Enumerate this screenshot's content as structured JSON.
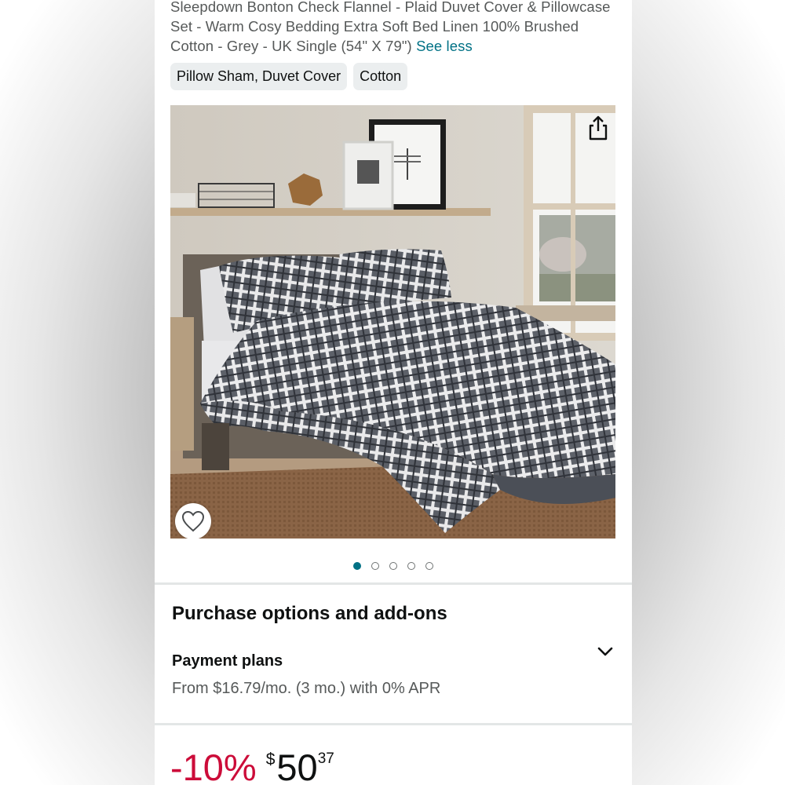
{
  "product": {
    "title": "Sleepdown Bonton Check Flannel - Plaid Duvet Cover & Pillowcase Set - Warm Cosy Bedding Extra Soft Bed Linen 100% Brushed Cotton - Grey - UK Single (54\" X 79\")",
    "see_less": "See less",
    "tags": [
      "Pillow Sham, Duvet Cover",
      "Cotton"
    ],
    "image_alt": "Grey plaid duvet cover and pillowcases on a bed",
    "image_count": 5,
    "active_image_index": 0
  },
  "purchase": {
    "heading": "Purchase options and add-ons",
    "payment_plans_label": "Payment plans",
    "payment_plans_detail": "From $16.79/mo. (3 mo.) with 0% APR"
  },
  "price": {
    "discount": "-10%",
    "currency": "$",
    "whole": "50",
    "fraction": "37"
  },
  "icons": {
    "share": "share-icon",
    "wishlist": "heart-icon",
    "expand": "chevron-down-icon"
  },
  "colors": {
    "link": "#007185",
    "discount": "#cc0c39",
    "text": "#0f1111",
    "secondary_text": "#565959"
  }
}
